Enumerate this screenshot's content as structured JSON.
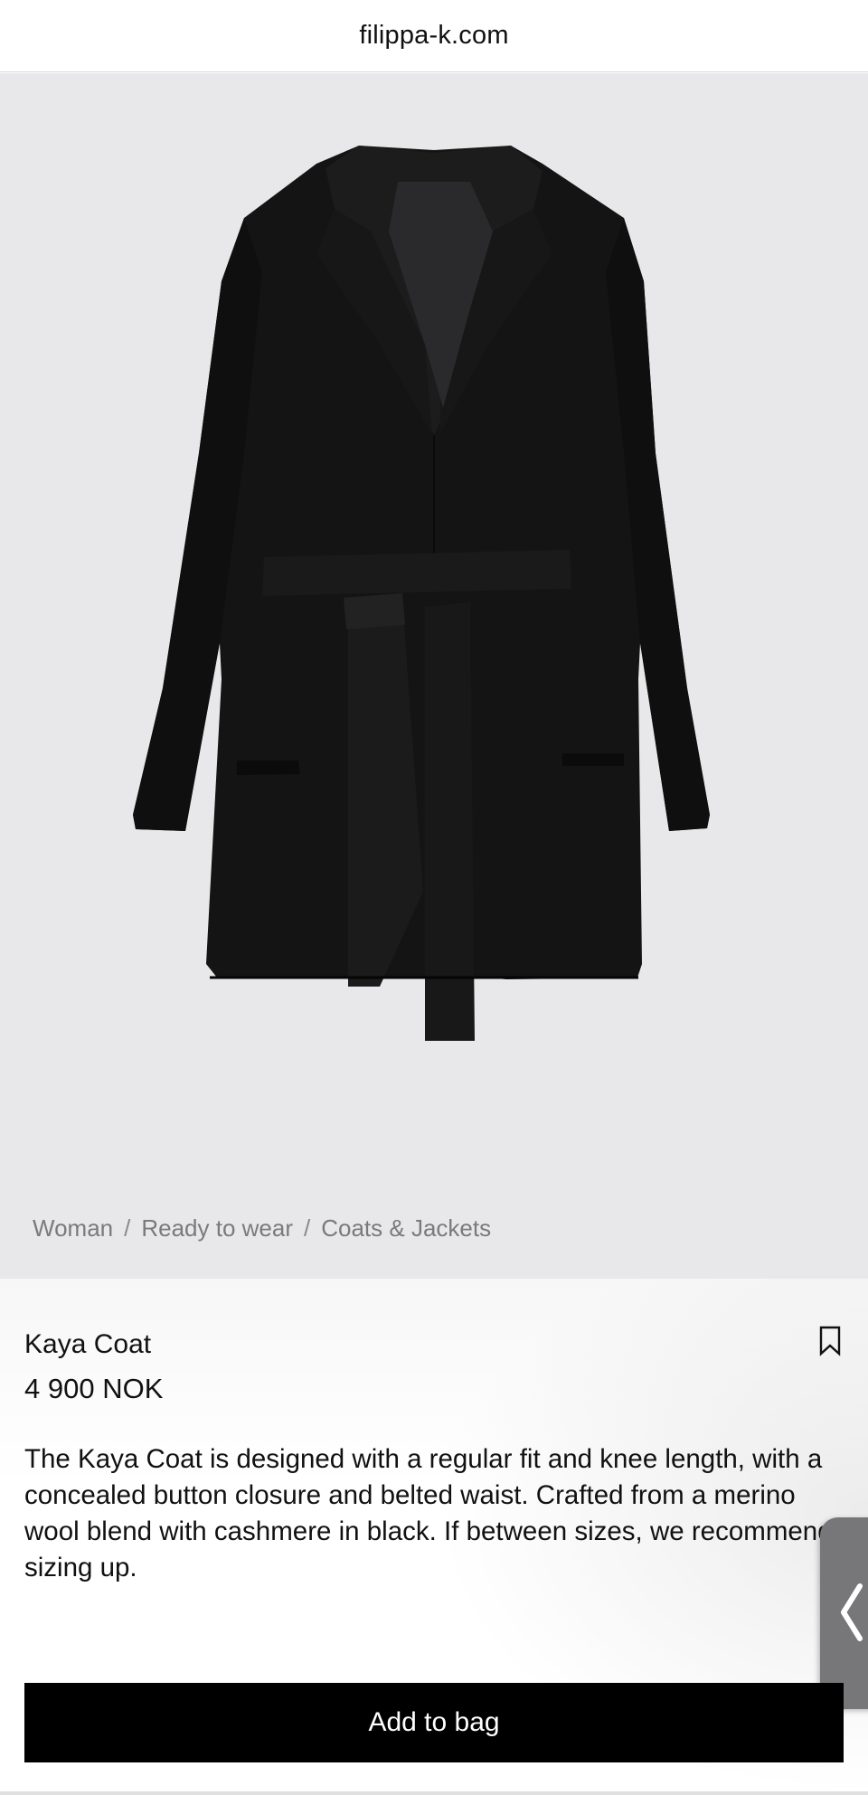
{
  "browser": {
    "url": "filippa-k.com"
  },
  "hero": {
    "image_icon": "coat-product-image",
    "background": "#e8e8ea"
  },
  "breadcrumb": {
    "items": [
      "Woman",
      "Ready to wear",
      "Coats & Jackets"
    ],
    "separator": "/"
  },
  "product": {
    "name": "Kaya Coat",
    "price": "4 900 NOK",
    "description": "The Kaya Coat is designed with a regular fit and knee length, with a concealed button closure and belted waist. Crafted from a merino wool blend with cashmere in black. If between sizes, we recommend sizing up.",
    "bookmark_icon": "bookmark-icon"
  },
  "actions": {
    "add_to_bag_label": "Add to bag"
  },
  "side_tab": {
    "icon": "chevron-left-icon",
    "color": "#777779"
  }
}
